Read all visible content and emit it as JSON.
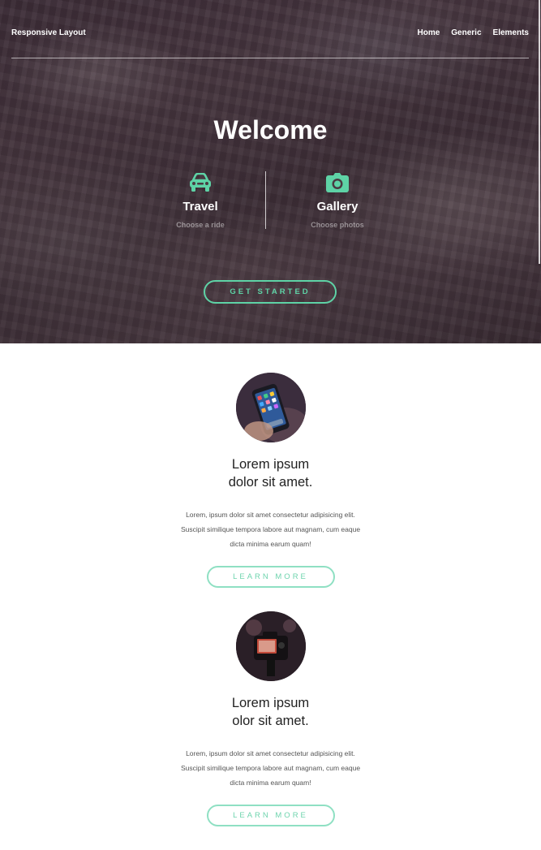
{
  "header": {
    "brand": "Responsive Layout",
    "nav": [
      "Home",
      "Generic",
      "Elements"
    ]
  },
  "hero": {
    "title": "Welcome",
    "features": [
      {
        "icon": "car-icon",
        "title": "Travel",
        "subtitle": "Choose a ride"
      },
      {
        "icon": "camera-icon",
        "title": "Gallery",
        "subtitle": "Choose photos"
      }
    ],
    "cta_label": "GET STARTED"
  },
  "cards": [
    {
      "image": "smartphone-photo",
      "title_line1": "Lorem ipsum",
      "title_line2": "dolor sit amet.",
      "text": "Lorem, ipsum dolor sit amet consectetur adipisicing elit. Suscipit similique tempora labore aut magnam, cum eaque dicta minima earum quam!",
      "button_label": "LEARN MORE"
    },
    {
      "image": "camera-photo",
      "title_line1": "Lorem ipsum",
      "title_line2": "olor sit amet.",
      "text": "Lorem, ipsum dolor sit amet consectetur adipisicing elit. Suscipit similique tempora labore aut magnam, cum eaque dicta minima earum quam!",
      "button_label": "LEARN MORE"
    }
  ],
  "colors": {
    "accent": "#5ed3a6",
    "accent_light": "#8fe0c3",
    "hero_overlay": "#3e2f37"
  }
}
